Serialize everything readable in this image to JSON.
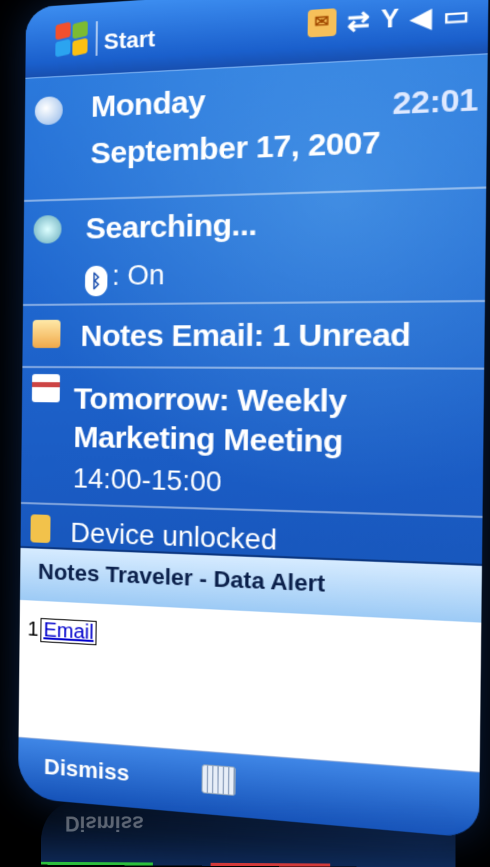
{
  "titlebar": {
    "title": "Start",
    "icons": [
      "windows-logo-icon",
      "mail-notification-icon",
      "sync-arrows-icon",
      "signal-antenna-icon",
      "speaker-icon",
      "battery-icon"
    ]
  },
  "today": {
    "day": "Monday",
    "date": "September 17, 2007",
    "time": "22:01",
    "wireless_status": "Searching...",
    "bluetooth_label": ": On",
    "email": "Notes Email: 1 Unread",
    "appointment_title": "Tomorrow: Weekly Marketing Meeting",
    "appointment_time": "14:00-15:00",
    "device_lock": "Device unlocked"
  },
  "dialog": {
    "title": "Notes Traveler - Data Alert",
    "count": "1",
    "link": "Email"
  },
  "softkeys": {
    "left": "Dismiss",
    "center_icon": "keyboard-icon"
  },
  "reflection_text": "Dismiss",
  "colors": {
    "background": "#1a5bc3",
    "dialog_title": "#9ccaf5",
    "link": "#0000cc"
  }
}
